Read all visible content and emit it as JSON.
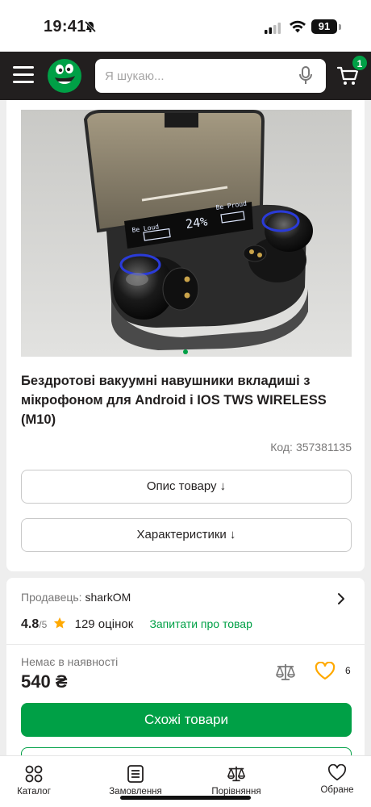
{
  "status_bar": {
    "time": "19:41",
    "battery": "91"
  },
  "header": {
    "search_placeholder": "Я шукаю...",
    "cart_count": "1",
    "colors": {
      "background": "#221f1f",
      "accent": "#00a046"
    }
  },
  "product": {
    "title": "Бездротові вакуумні навушники вкладиші з мікрофоном для Android і IOS TWS WIRELESS (M10)",
    "code_label": "Код:",
    "code_value": "357381135",
    "gallery": {
      "slides": 1,
      "active": 1,
      "case_display": {
        "left": "Be Loud",
        "center": "24%",
        "right": "Be Proud"
      }
    },
    "description_button": "Опис товару ↓",
    "specs_button": "Характеристики ↓"
  },
  "seller": {
    "label": "Продавець:",
    "name": "sharkOM",
    "rating": "4.8",
    "rating_max": "/5",
    "reviews": "129 оцінок",
    "ask_link": "Запитати про товар"
  },
  "offer": {
    "availability": "Немає в наявності",
    "price": "540 ₴",
    "favorites_count": "6",
    "similar_button": "Схожі товари"
  },
  "bottom_nav": {
    "catalog": "Каталог",
    "orders": "Замовлення",
    "compare": "Порівняння",
    "favorites": "Обране"
  }
}
